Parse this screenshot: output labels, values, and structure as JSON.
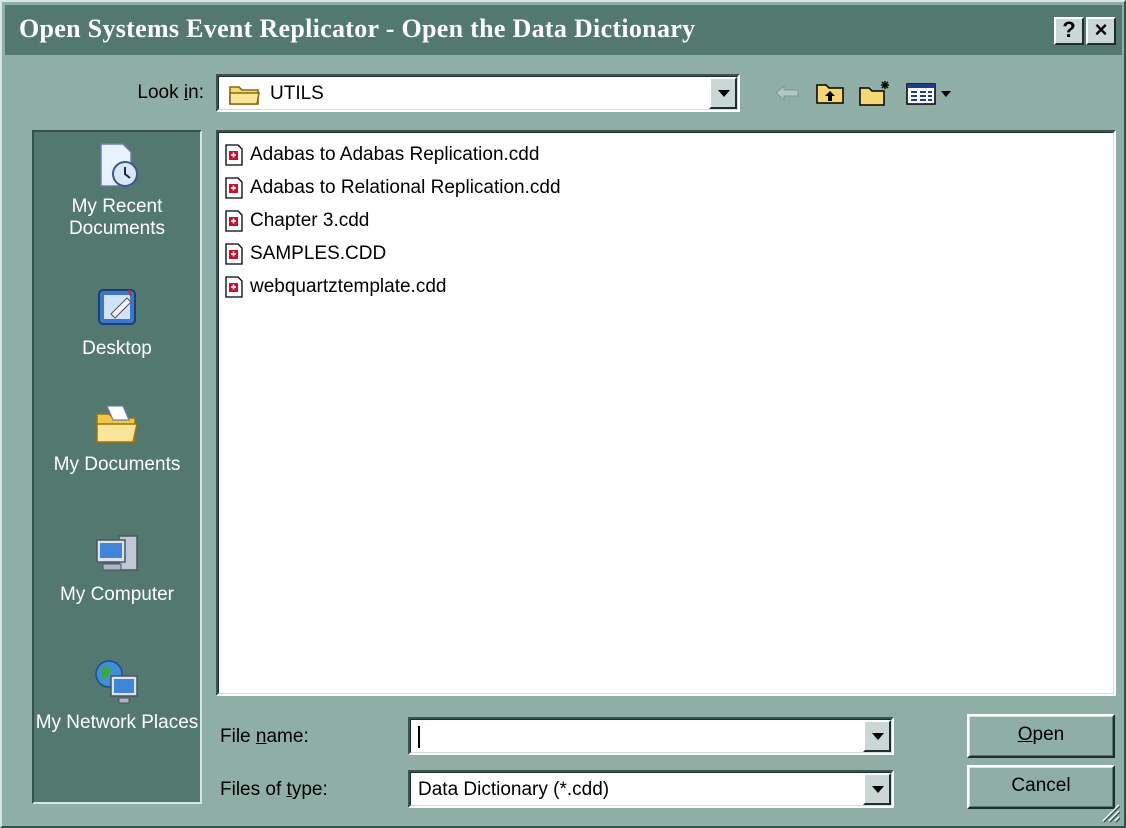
{
  "window": {
    "title": "Open Systems Event Replicator - Open the Data Dictionary",
    "help_label": "?",
    "close_label": "×"
  },
  "lookin": {
    "label_pre": "Look ",
    "label_accel": "i",
    "label_post": "n:",
    "value": "UTILS",
    "tools": [
      "back-arrow-icon",
      "up-one-level-icon",
      "create-new-folder-icon",
      "views-menu-icon"
    ]
  },
  "places": [
    {
      "label": "My Recent Documents",
      "icon": "recent-documents-icon"
    },
    {
      "label": "Desktop",
      "icon": "desktop-icon"
    },
    {
      "label": "My Documents",
      "icon": "my-documents-icon"
    },
    {
      "label": "My Computer",
      "icon": "my-computer-icon"
    },
    {
      "label": "My Network Places",
      "icon": "network-places-icon"
    }
  ],
  "files": [
    "Adabas to Adabas Replication.cdd",
    "Adabas to Relational Replication.cdd",
    "Chapter 3.cdd",
    "SAMPLES.CDD",
    "webquartztemplate.cdd"
  ],
  "filename": {
    "label_pre": "File ",
    "label_accel": "n",
    "label_post": "ame:",
    "value": ""
  },
  "filetype": {
    "label_pre": "Files of ",
    "label_accel": "t",
    "label_post": "ype:",
    "value": "Data Dictionary (*.cdd)"
  },
  "buttons": {
    "open_accel": "O",
    "open_rest": "pen",
    "cancel": "Cancel"
  },
  "colors": {
    "frame": "#8FAFA6",
    "titlebar": "#52786F",
    "places_bar": "#52786F"
  }
}
